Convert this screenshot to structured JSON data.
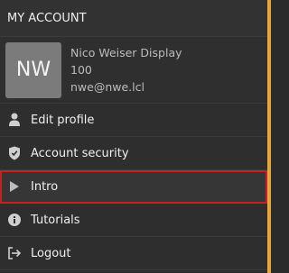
{
  "header": {
    "title": "MY ACCOUNT"
  },
  "profile": {
    "initials": "NW",
    "name": "Nico Weiser Display",
    "id": "100",
    "email": "nwe@nwe.lcl"
  },
  "menu": [
    {
      "label": "Edit profile",
      "icon": "user-icon"
    },
    {
      "label": "Account security",
      "icon": "shield-icon"
    },
    {
      "label": "Intro",
      "icon": "play-icon",
      "active": true
    },
    {
      "label": "Tutorials",
      "icon": "info-icon"
    },
    {
      "label": "Logout",
      "icon": "logout-icon"
    }
  ],
  "colors": {
    "accent": "#e8a33a",
    "active_outline": "#c8202a",
    "background": "#2e2e2e"
  }
}
